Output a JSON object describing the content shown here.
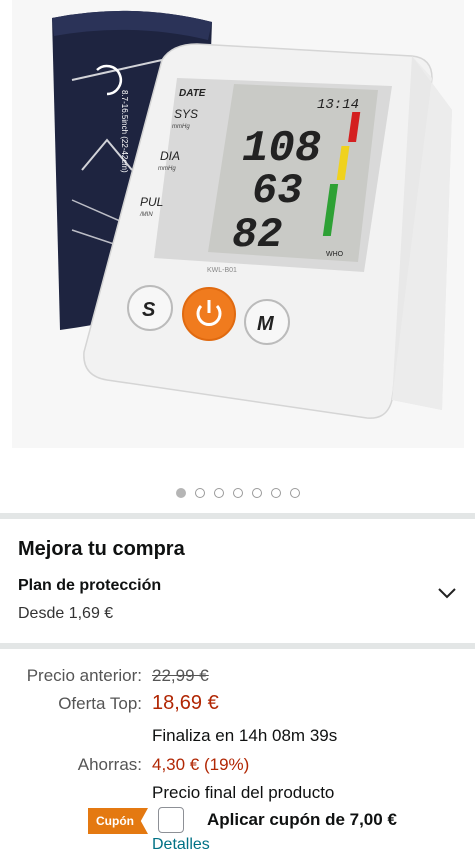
{
  "product": {
    "model_label": "KWL-B01",
    "display": {
      "date": "DATE",
      "time": "13:14",
      "sys_label": "SYS",
      "sys_unit": "mmHg",
      "dia_label": "DIA",
      "dia_unit": "mmHg",
      "pul_label": "PUL",
      "pul_unit": "/MIN",
      "sys_value": "108",
      "dia_value": "63",
      "pul_value": "82",
      "who": "WHO"
    },
    "buttons": {
      "s": "S",
      "m": "M"
    },
    "cuff_text": "8.7-16.5inch (22-42cm)"
  },
  "carousel": {
    "total": 7,
    "active_index": 0
  },
  "upgrade": {
    "title": "Mejora tu compra",
    "plan_title": "Plan de protección",
    "plan_price": "Desde 1,69 €"
  },
  "pricing": {
    "previous_label": "Precio anterior:",
    "previous_value": "22,99 €",
    "offer_label": "Oferta Top:",
    "offer_value": "18,69 €",
    "ends_in": "Finaliza en 14h 08m 39s",
    "savings_label": "Ahorras:",
    "savings_value": "4,30 € (19%)",
    "final_price_note": "Precio final del producto"
  },
  "coupon": {
    "badge": "Cupón",
    "text": "Aplicar cupón de 7,00 €",
    "details_link": "Detalles"
  },
  "colors": {
    "price_red": "#b12704",
    "coupon_orange": "#e47911",
    "link_teal": "#007185",
    "power_orange": "#f07b1e",
    "cuff_navy": "#1e2440"
  }
}
